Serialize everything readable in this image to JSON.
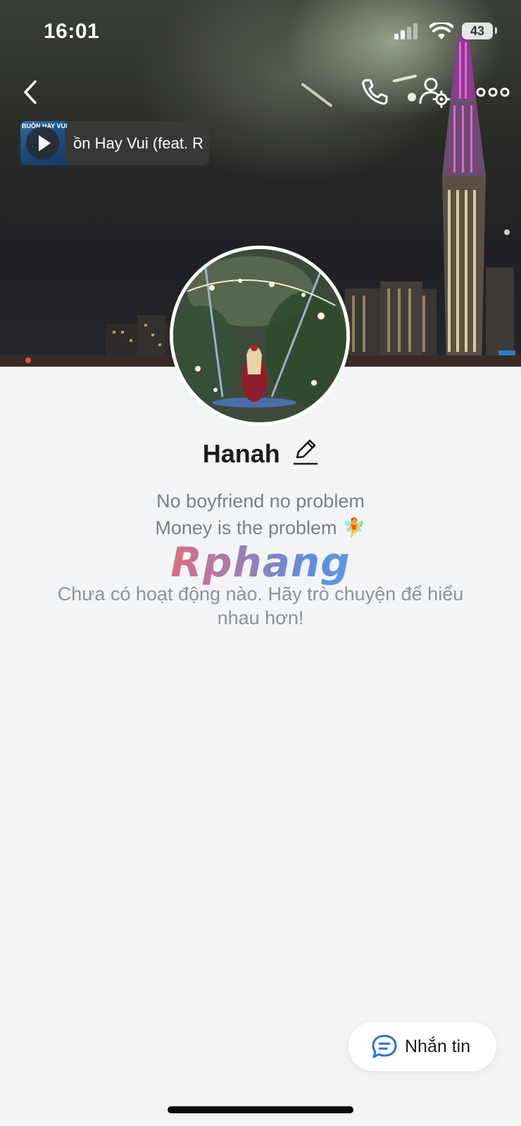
{
  "status_bar": {
    "time": "16:01",
    "battery": "43"
  },
  "header": {
    "back_icon": "chevron-left-icon",
    "call_icon": "phone-icon",
    "profile_settings_icon": "user-gear-icon",
    "more_icon": "more-dots-icon"
  },
  "music": {
    "thumbnail_text": "BUỒN HAY VUI",
    "title": "ồn Hay Vui (feat. R"
  },
  "profile": {
    "name": "Hanah",
    "bio_line1": "No boyfriend no problem",
    "bio_line2": "Money is the problem 🧚",
    "empty_activity": "Chưa có hoạt động nào. Hãy trò chuyện để hiểu nhau hơn!"
  },
  "watermark": "Rphang",
  "actions": {
    "message_label": "Nhắn tin"
  },
  "colors": {
    "background": "#f3f4f6",
    "accent": "#2f6fdc",
    "text_primary": "#1c1c1e",
    "text_secondary": "#7b7f86"
  }
}
